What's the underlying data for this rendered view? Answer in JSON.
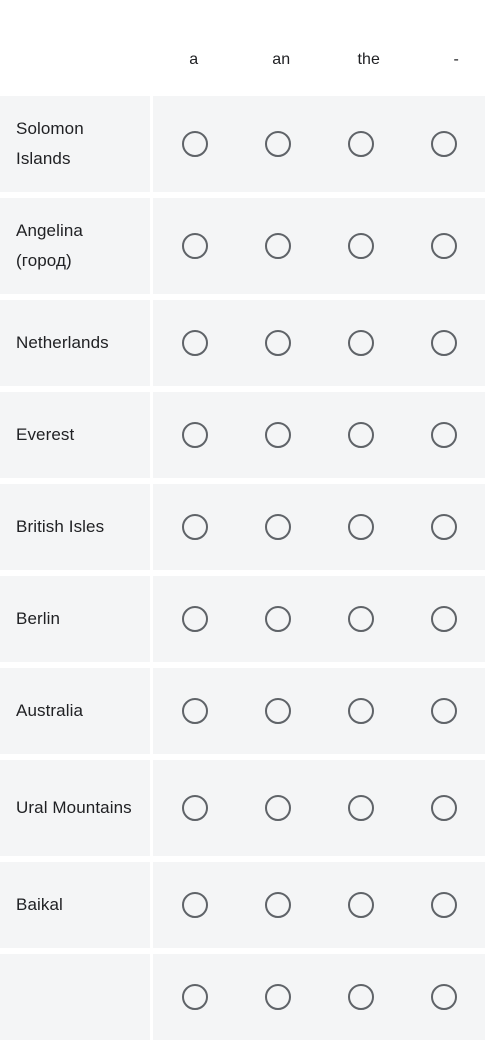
{
  "grid": {
    "columns": [
      "a",
      "an",
      "the",
      "-"
    ],
    "rows": [
      {
        "label": "Solomon Islands",
        "two_line": true,
        "selected": null
      },
      {
        "label": "Angelina (город)",
        "two_line": true,
        "selected": null
      },
      {
        "label": "Netherlands",
        "two_line": false,
        "selected": null
      },
      {
        "label": "Everest",
        "two_line": false,
        "selected": null
      },
      {
        "label": "British Isles",
        "two_line": false,
        "selected": null
      },
      {
        "label": "Berlin",
        "two_line": false,
        "selected": null
      },
      {
        "label": "Australia",
        "two_line": false,
        "selected": null
      },
      {
        "label": "Ural Mountains",
        "two_line": true,
        "selected": null
      },
      {
        "label": "Baikal",
        "two_line": false,
        "selected": null
      },
      {
        "label": "",
        "two_line": false,
        "selected": null
      }
    ]
  },
  "colors": {
    "page_background": "#ffffff",
    "cell_background": "#f4f5f6",
    "text": "#202124",
    "radio_ring": "#5f6368"
  }
}
